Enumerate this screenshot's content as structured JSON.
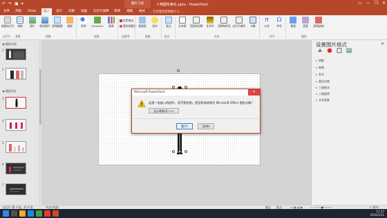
{
  "titlebar": {
    "quick_access": [
      "↶",
      "↷",
      "▣",
      "▾"
    ],
    "context_tab": "图片工具",
    "doc_title": "人物图形美化.pptx - PowerPoint",
    "window_controls": [
      "▭",
      "—",
      "❐",
      "✕"
    ]
  },
  "tabs": [
    "文件",
    "开始",
    "iSlide",
    "插入",
    "设计",
    "切换",
    "动画",
    "幻灯片放映",
    "审阅",
    "视图",
    "格式"
  ],
  "active_tab_index": 3,
  "search_placeholder": "告诉我您想要做什么...",
  "ribbon": {
    "buttons": [
      "新建幻灯片",
      "表格",
      "图片",
      "联机图片",
      "屏幕截图",
      "相册",
      "形状",
      "SmartArt",
      "图表",
      "应用商店",
      "我的加载项",
      "超链接",
      "动作",
      "批注",
      "文本框",
      "页眉和页脚",
      "艺术字",
      "日期和时间",
      "幻灯片编号",
      "对象",
      "公式",
      "符号",
      "视频",
      "音频",
      "屏幕录制"
    ],
    "small_buttons": [
      "应用商店",
      "我的加载项"
    ],
    "groups": [
      "幻灯片",
      "表格",
      "图像",
      "插图",
      "加载项",
      "链接",
      "批注",
      "文本",
      "符号",
      "媒体"
    ]
  },
  "left_panel": {
    "sections": [
      "图形分析",
      "图形设计"
    ],
    "slides": [
      {
        "num": "1",
        "bg": "#3a3a3a"
      },
      {
        "num": "2",
        "bg": "#f7f7f7"
      },
      {
        "num": "3",
        "bg": "#f7f7f7"
      },
      {
        "num": "4",
        "bg": "#f7f7f7"
      },
      {
        "num": "5",
        "bg": "#f7f7f7"
      },
      {
        "num": "6",
        "bg": "#333333"
      },
      {
        "num": "7",
        "bg": "#2e2e2e"
      }
    ]
  },
  "dialog": {
    "title": "Microsoft PowerPoint",
    "close": "✕",
    "message": "这是一张嵌入的图片，而不是绘图。是否将其转换为 Microsoft Office 图形对象?",
    "help_button": "显示帮助(E) >>",
    "yes_button": "是(Y)",
    "no_button": "否(N)"
  },
  "format_pane": {
    "title": "设置图片格式",
    "close": "✕",
    "options": [
      "阴影",
      "映像",
      "发光",
      "柔化边缘",
      "三维格式",
      "三维旋转",
      "艺术效果"
    ]
  },
  "statusbar": {
    "slide_info": "幻灯片 第 3 张，共 9 张",
    "language": "中文(中国)",
    "notes": "备注",
    "comments": "批注",
    "zoom": "+ 58%"
  },
  "taskbar": {
    "time": "11:37",
    "date": "2016/1/31"
  },
  "colors": {
    "accent": "#b7472a",
    "selection": "#c0392b",
    "warning": "#f4c20d"
  }
}
